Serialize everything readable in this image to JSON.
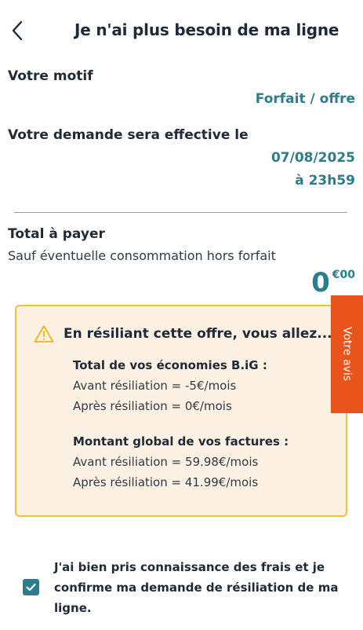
{
  "header": {
    "title": "Je n'ai plus besoin de ma ligne",
    "back_icon": "chevron-left-icon"
  },
  "motif": {
    "label": "Votre motif",
    "value": "Forfait / offre"
  },
  "effective": {
    "label": "Votre demande sera effective le",
    "date": "07/08/2025",
    "time": "à 23h59"
  },
  "total": {
    "label": "Total à payer",
    "note": "Sauf éventuelle consommation hors forfait",
    "price_int": "0",
    "price_dec": "€00"
  },
  "warning": {
    "icon": "warning-triangle-icon",
    "title": "En résiliant cette offre, vous allez...",
    "savings_title": "Total de vos économies B.iG :",
    "savings_before": "Avant résiliation = -5€/mois",
    "savings_after": "Après résiliation = 0€/mois",
    "bills_title": "Montant global de vos factures :",
    "bills_before": "Avant résiliation = 59.98€/mois",
    "bills_after": "Après résiliation = 41.99€/mois"
  },
  "feedback": {
    "label": "Votre avis"
  },
  "confirmation": {
    "checked": true,
    "text": "J'ai bien pris connaissance des frais et je confirme ma demande de résiliation de ma ligne."
  },
  "colors": {
    "accent": "#2b7d8c",
    "warning_border": "#f2c233",
    "warning_bg": "#fdf1e4",
    "feedback_bg": "#e8541b",
    "text": "#1f2a37"
  }
}
